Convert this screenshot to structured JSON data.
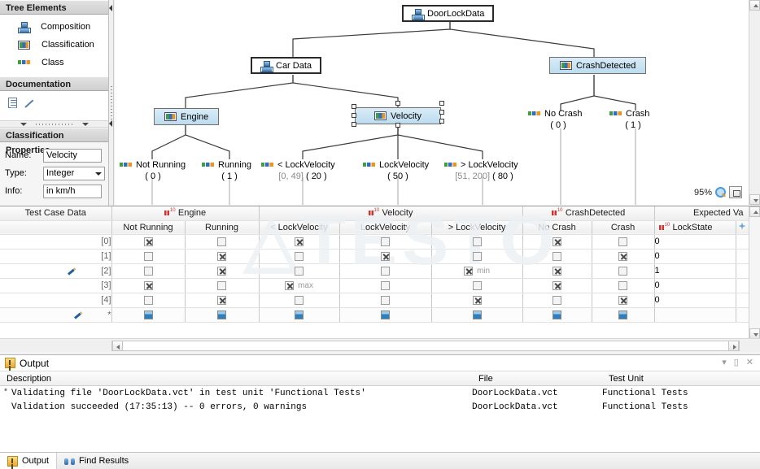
{
  "sidebar": {
    "tree_elements": {
      "title": "Tree Elements",
      "items": [
        {
          "label": "Composition",
          "icon": "composition-icon"
        },
        {
          "label": "Classification",
          "icon": "classification-icon"
        },
        {
          "label": "Class",
          "icon": "class-icon"
        }
      ]
    },
    "documentation": {
      "title": "Documentation"
    },
    "classification_properties": {
      "title": "Classification Properties",
      "fields": [
        {
          "label": "Name:",
          "value": "Velocity",
          "type": "text"
        },
        {
          "label": "Type:",
          "value": "Integer",
          "type": "select"
        },
        {
          "label": "Info:",
          "value": "in km/h",
          "type": "text"
        }
      ]
    }
  },
  "canvas": {
    "zoom_label": "95%",
    "nodes": {
      "root": "DoorLockData",
      "car_data": "Car Data",
      "crash_detected": "CrashDetected",
      "engine": "Engine",
      "velocity": "Velocity",
      "not_running": "Not Running",
      "not_running_val": "( 0 )",
      "running": "Running",
      "running_val": "( 1 )",
      "lt_lockvelocity": "< LockVelocity",
      "lt_lockvelocity_range": "[0, 49]",
      "lt_lockvelocity_val": "( 20 )",
      "lockvelocity": "LockVelocity",
      "lockvelocity_val": "( 50 )",
      "gt_lockvelocity": "> LockVelocity",
      "gt_lockvelocity_range": "[51, 200]",
      "gt_lockvelocity_val": "( 80 )",
      "no_crash": "No Crash",
      "no_crash_val": "( 0 )",
      "crash": "Crash",
      "crash_val": "( 1 )"
    }
  },
  "grid": {
    "group_headers": [
      {
        "label": "Test Case Data",
        "icon": false
      },
      {
        "label": "Engine",
        "icon": true
      },
      {
        "label": "Velocity",
        "icon": true
      },
      {
        "label": "CrashDetected",
        "icon": true
      },
      {
        "label": "Expected Va",
        "icon": false
      }
    ],
    "columns": [
      "Not Running",
      "Running",
      "< LockVelocity",
      "LockVelocity",
      "> LockVelocity",
      "No Crash",
      "Crash",
      "LockState"
    ],
    "rows": [
      {
        "index": "[0]",
        "pencil": false,
        "cells": [
          {
            "checked": true
          },
          {
            "checked": false
          },
          {
            "checked": true,
            "tag": ""
          },
          {
            "checked": false
          },
          {
            "checked": false
          },
          {
            "checked": true
          },
          {
            "checked": false
          }
        ],
        "lockstate": "0"
      },
      {
        "index": "[1]",
        "pencil": false,
        "cells": [
          {
            "checked": false
          },
          {
            "checked": true
          },
          {
            "checked": false
          },
          {
            "checked": true
          },
          {
            "checked": false
          },
          {
            "checked": false
          },
          {
            "checked": true
          }
        ],
        "lockstate": "0"
      },
      {
        "index": "[2]",
        "pencil": true,
        "cells": [
          {
            "checked": false
          },
          {
            "checked": true
          },
          {
            "checked": false
          },
          {
            "checked": false
          },
          {
            "checked": true,
            "tag": "min"
          },
          {
            "checked": true
          },
          {
            "checked": false
          }
        ],
        "lockstate": "1"
      },
      {
        "index": "[3]",
        "pencil": false,
        "cells": [
          {
            "checked": true
          },
          {
            "checked": false
          },
          {
            "checked": true,
            "tag": "max"
          },
          {
            "checked": false
          },
          {
            "checked": false
          },
          {
            "checked": true
          },
          {
            "checked": false
          }
        ],
        "lockstate": "0"
      },
      {
        "index": "[4]",
        "pencil": false,
        "cells": [
          {
            "checked": false
          },
          {
            "checked": true
          },
          {
            "checked": false
          },
          {
            "checked": false
          },
          {
            "checked": true
          },
          {
            "checked": false
          },
          {
            "checked": true
          }
        ],
        "lockstate": "0"
      },
      {
        "index": "*",
        "pencil": true,
        "new_row": true,
        "cells": [
          {},
          {},
          {},
          {},
          {},
          {},
          {}
        ],
        "lockstate": ""
      }
    ]
  },
  "output": {
    "title": "Output",
    "columns": {
      "description": "Description",
      "file": "File",
      "test_unit": "Test Unit"
    },
    "rows": [
      {
        "bullet": "*",
        "description": "Validating file 'DoorLockData.vct' in test unit 'Functional Tests'",
        "file": "DoorLockData.vct",
        "test_unit": "Functional Tests"
      },
      {
        "bullet": "",
        "description": "Validation succeeded (17:35:13) -- 0 errors, 0 warnings",
        "file": "DoorLockData.vct",
        "test_unit": "Functional Tests"
      }
    ]
  },
  "status_tabs": [
    {
      "label": "Output",
      "icon": "output-icon",
      "active": true
    },
    {
      "label": "Find Results",
      "icon": "binoculars-icon",
      "active": false
    }
  ]
}
